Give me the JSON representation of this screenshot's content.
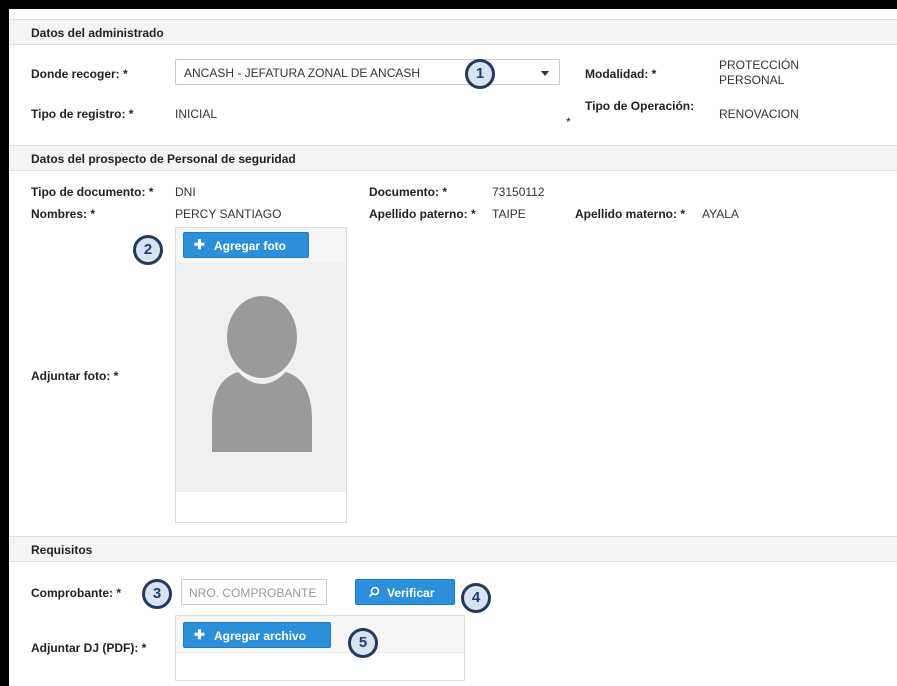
{
  "administrado": {
    "header": "Datos del administrado",
    "donde_recoger_label": "Donde recoger: *",
    "donde_recoger_value": "ANCASH - JEFATURA ZONAL DE ANCASH",
    "modalidad_label": "Modalidad: *",
    "modalidad_value_line1": "PROTECCIÓN",
    "modalidad_value_line2": "PERSONAL",
    "tipo_registro_label": "Tipo de registro: *",
    "tipo_registro_value": "INICIAL",
    "tipo_operacion_label": "Tipo de Operación:",
    "tipo_operacion_asterisk": "*",
    "tipo_operacion_value": "RENOVACION"
  },
  "prospecto": {
    "header": "Datos del prospecto de Personal de seguridad",
    "tipo_documento_label": "Tipo de documento: *",
    "tipo_documento_value": "DNI",
    "documento_label": "Documento: *",
    "documento_value": "73150112",
    "nombres_label": "Nombres: *",
    "nombres_value": "PERCY SANTIAGO",
    "apellido_paterno_label": "Apellido paterno: *",
    "apellido_paterno_value": "TAIPE",
    "apellido_materno_label": "Apellido materno: *",
    "apellido_materno_value": "AYALA",
    "adjuntar_foto_label": "Adjuntar foto: *",
    "agregar_foto_button": "Agregar foto"
  },
  "requisitos": {
    "header": "Requisitos",
    "comprobante_label": "Comprobante: *",
    "comprobante_placeholder": "NRO. COMPROBANTE",
    "comprobante_value": "",
    "verificar_button": "Verificar",
    "adjuntar_dj_label": "Adjuntar DJ (PDF): *",
    "agregar_archivo_button": "Agregar archivo"
  },
  "callouts": [
    "1",
    "2",
    "3",
    "4",
    "5"
  ],
  "colors": {
    "button_blue": "#2b8fd9",
    "callout_border": "#243a5c",
    "callout_fill": "#d7e3f1",
    "avatar_gray": "#9a9a9a"
  },
  "icons": {
    "select_caret": "chevron-down-icon",
    "add": "plus-icon",
    "search": "search-icon",
    "avatar": "user-silhouette-icon"
  }
}
